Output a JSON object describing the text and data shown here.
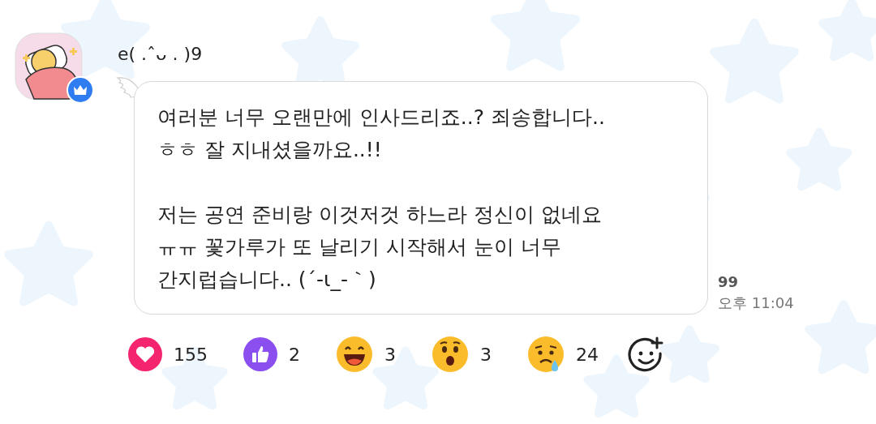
{
  "author": {
    "name": "e( .ˆᴗ . )9"
  },
  "message": {
    "paragraphs": [
      "여러분 너무 오랜만에 인사드리죠..? 죄송합니다..\nㅎㅎ 잘 지내셨을까요..!!",
      "저는 공연 준비랑 이것저것 하느라 정신이 없네요\nㅠㅠ 꽃가루가 또 날리기 시작해서 눈이 너무\n간지럽습니다.. (´-ι_-｀)"
    ],
    "unread": "99",
    "time": "오후 11:04"
  },
  "reactions": [
    {
      "kind": "heart",
      "count": "155"
    },
    {
      "kind": "like",
      "count": "2"
    },
    {
      "kind": "laugh",
      "count": "3"
    },
    {
      "kind": "wow",
      "count": "3"
    },
    {
      "kind": "sad",
      "count": "24"
    }
  ]
}
